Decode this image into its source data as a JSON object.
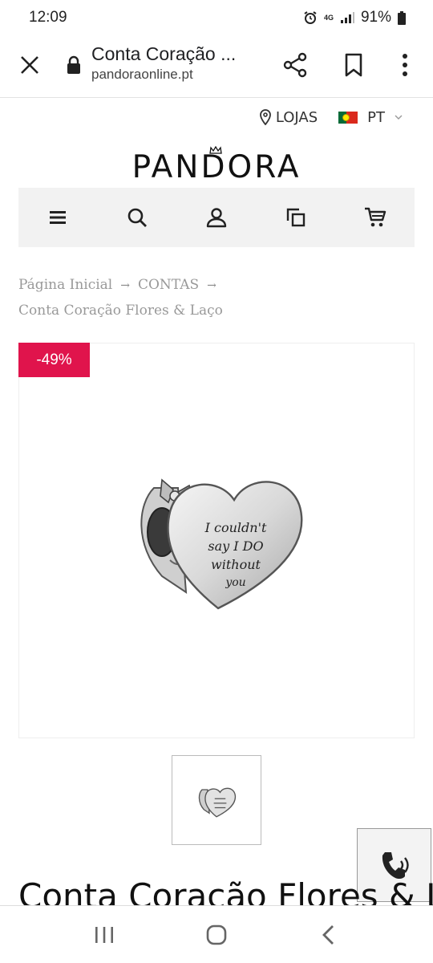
{
  "status_bar": {
    "time": "12:09",
    "network": "4G",
    "battery": "91%"
  },
  "browser": {
    "page_title": "Conta Coração ...",
    "url": "pandoraonline.pt"
  },
  "top_links": {
    "stores_label": "LOJAS",
    "language_label": "PT"
  },
  "logo": {
    "text": "PANDORA"
  },
  "nav": {
    "items": [
      "menu-icon",
      "search-icon",
      "account-icon",
      "compare-icon",
      "cart-icon"
    ]
  },
  "breadcrumb": {
    "items": [
      "Página Inicial",
      "CONTAS",
      "Conta Coração Flores & Laço"
    ]
  },
  "product": {
    "discount_badge": "-49%",
    "engraving_lines": [
      "I couldn't",
      "say I DO",
      "without",
      "you"
    ],
    "title": "Conta Coração Flores & Laço"
  },
  "colors": {
    "accent": "#e0144c",
    "nav_bg": "#f2f2f2",
    "breadcrumb_text": "#999999"
  }
}
